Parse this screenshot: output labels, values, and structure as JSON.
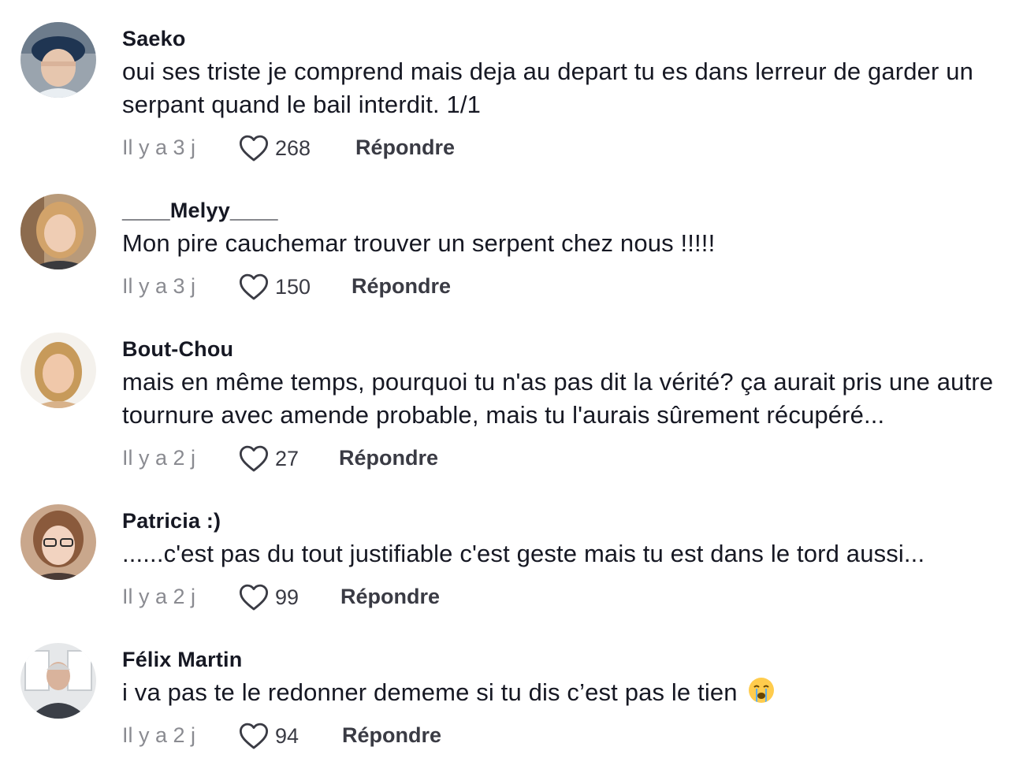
{
  "comments": [
    {
      "username": "Saeko",
      "text": "oui ses triste je comprend mais deja au depart tu es dans lerreur de garder un serpant quand le bail interdit. 1/1",
      "time": "Il y a 3 j",
      "likes": "268",
      "reply_label": "Répondre",
      "avatar_icon": "user-avatar-icon"
    },
    {
      "username": "____Melyy____",
      "text": "Mon pire cauchemar trouver un serpent chez nous !!!!!",
      "time": "Il y a 3 j",
      "likes": "150",
      "reply_label": "Répondre",
      "avatar_icon": "user-avatar-icon"
    },
    {
      "username": "Bout-Chou",
      "text": "mais en même temps, pourquoi tu n'as pas dit la vérité? ça aurait pris une autre tournure avec amende probable, mais tu l'aurais sûrement récupéré...",
      "time": "Il y a 2 j",
      "likes": "27",
      "reply_label": "Répondre",
      "avatar_icon": "user-avatar-icon"
    },
    {
      "username": "Patricia :)",
      "text": "......c'est pas du tout justifiable c'est geste mais tu est dans le tord aussi...",
      "time": "Il y a 2 j",
      "likes": "99",
      "reply_label": "Répondre",
      "avatar_icon": "user-avatar-icon"
    },
    {
      "username": "Félix Martin",
      "text": "i va pas te le redonner dememe si tu dis c’est pas le tien",
      "emoji": "crying-face-icon",
      "time": "Il y a 2 j",
      "likes": "94",
      "reply_label": "Répondre",
      "avatar_icon": "user-avatar-icon"
    }
  ],
  "colors": {
    "text_primary": "#161823",
    "text_secondary": "#8a8b91",
    "action": "#3a3b44"
  }
}
